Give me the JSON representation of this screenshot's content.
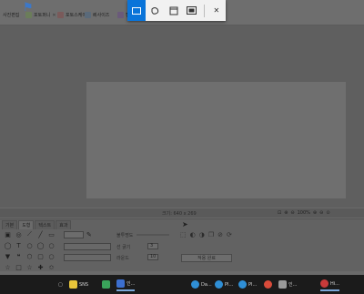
{
  "tabs": [
    {
      "label": "사진편집",
      "color": "#8a6a6a"
    },
    {
      "label": "포토퍼니",
      "color": "#6b7d5a"
    },
    {
      "label": "포토스케이프",
      "color": "#7a5a5a"
    },
    {
      "label": "리사이즈",
      "color": "#5a6a7a"
    },
    {
      "label": "캡쳐",
      "color": "#6a5a7a"
    }
  ],
  "snip_toolbar": {
    "rect_icon": "▭",
    "freeform_icon": "◌",
    "window_icon": "◱",
    "fullscreen_icon": "⛶",
    "close_icon": "✕"
  },
  "status": {
    "canvas_size": "크기: 640 x 269",
    "zoom_level": "100%"
  },
  "panel": {
    "tabs": [
      "기본",
      "도형",
      "텍스트",
      "효과"
    ],
    "selected_tab": 1,
    "labels": {
      "opacity": "불투명도",
      "thickness": "선 굵기",
      "round": "라운드",
      "thickness_value": "3",
      "round_value": "10"
    },
    "apply_label": "적용 완료"
  },
  "taskbar": {
    "apps": [
      {
        "label": "SNS",
        "color": "#e8c53a"
      },
      {
        "label": "",
        "color": "#3aa35a"
      },
      {
        "label": "인...",
        "color": "#3c6fcf"
      },
      {
        "label": "",
        "color": "#2f8fd6"
      },
      {
        "label": "Da...",
        "color": "#2f8fd6"
      },
      {
        "label": "PI...",
        "color": "#2f8fd6"
      },
      {
        "label": "PI...",
        "color": "#2f8fd6"
      },
      {
        "label": "",
        "color": "#d94b3a"
      },
      {
        "label": "인...",
        "color": "#9a9a9a"
      },
      {
        "label": "Hi...",
        "color": "#c83a3a"
      }
    ]
  }
}
